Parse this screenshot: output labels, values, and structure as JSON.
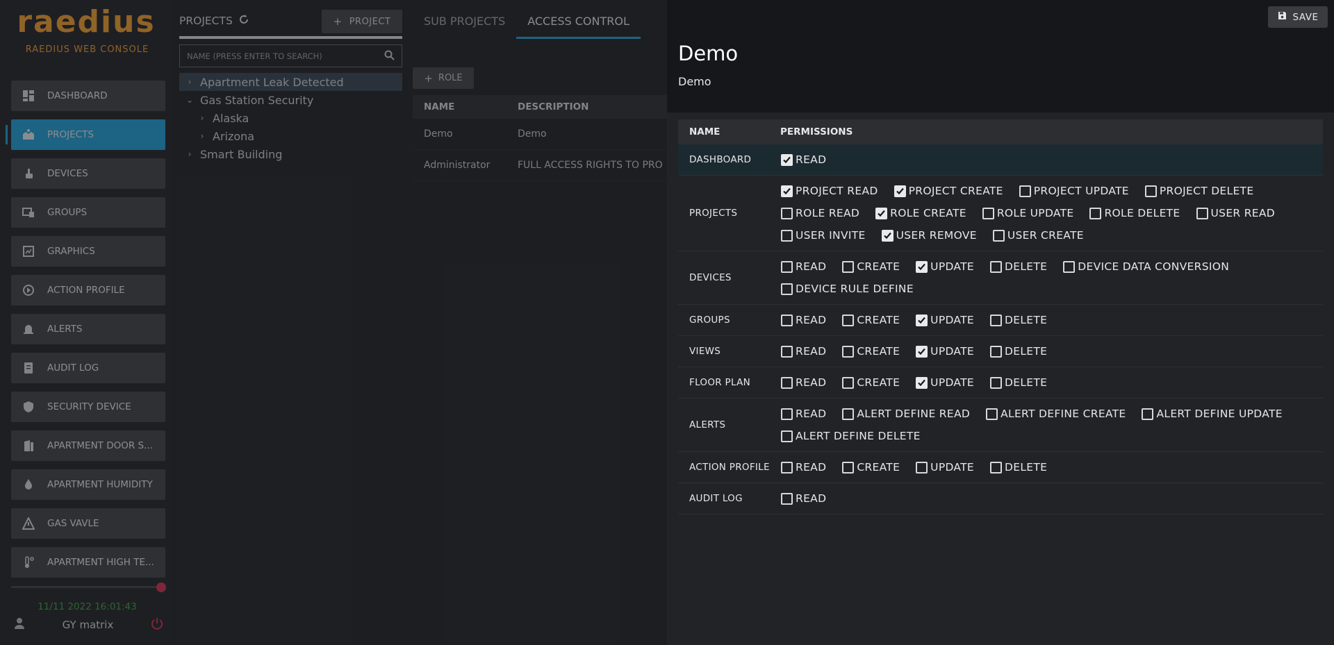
{
  "sidebar": {
    "logo": "raedius",
    "subtitle": "RAEDIUS WEB CONSOLE",
    "items": [
      {
        "label": "DASHBOARD",
        "icon": "dashboard-icon",
        "active": false
      },
      {
        "label": "PROJECTS",
        "icon": "projects-icon",
        "active": true
      },
      {
        "label": "DEVICES",
        "icon": "devices-icon",
        "active": false
      },
      {
        "label": "GROUPS",
        "icon": "groups-icon",
        "active": false
      },
      {
        "label": "GRAPHICS",
        "icon": "graphics-icon",
        "active": false
      },
      {
        "label": "ACTION PROFILE",
        "icon": "action-profile-icon",
        "active": false
      },
      {
        "label": "ALERTS",
        "icon": "alerts-icon",
        "active": false
      },
      {
        "label": "AUDIT LOG",
        "icon": "audit-log-icon",
        "active": false
      },
      {
        "label": "SECURITY DEVICE",
        "icon": "shield-icon",
        "active": false
      },
      {
        "label": "APARTMENT DOOR S...",
        "icon": "door-icon",
        "active": false
      },
      {
        "label": "APARTMENT HUMIDITY",
        "icon": "humidity-icon",
        "active": false
      },
      {
        "label": "GAS VAVLE",
        "icon": "warning-icon",
        "active": false
      },
      {
        "label": "APARTMENT HIGH TE...",
        "icon": "thermometer-icon",
        "active": false
      }
    ],
    "datetime": "11/11 2022 16:01:43",
    "user": "GY matrix"
  },
  "projects": {
    "title": "PROJECTS",
    "add_label": "PROJECT",
    "search_placeholder": "NAME (PRESS ENTER TO SEARCH)",
    "tree": [
      {
        "label": "Apartment Leak Detected",
        "level": 0,
        "expanded": false,
        "selected": true
      },
      {
        "label": "Gas Station Security",
        "level": 0,
        "expanded": true,
        "selected": false
      },
      {
        "label": "Alaska",
        "level": 1,
        "expanded": false,
        "selected": false
      },
      {
        "label": "Arizona",
        "level": 1,
        "expanded": false,
        "selected": false
      },
      {
        "label": "Smart Building",
        "level": 0,
        "expanded": false,
        "selected": false
      }
    ]
  },
  "main": {
    "tabs": [
      {
        "label": "SUB PROJECTS",
        "active": false
      },
      {
        "label": "ACCESS CONTROL",
        "active": true
      }
    ],
    "add_role_label": "ROLE",
    "table": {
      "headers": [
        "NAME",
        "DESCRIPTION"
      ],
      "rows": [
        [
          "Demo",
          "Demo"
        ],
        [
          "Administrator",
          "FULL ACCESS RIGHTS TO PRO"
        ]
      ]
    }
  },
  "panel": {
    "save_label": "SAVE",
    "role_name": "Demo",
    "role_description": "Demo",
    "headers": [
      "NAME",
      "PERMISSIONS"
    ],
    "rows": [
      {
        "name": "DASHBOARD",
        "highlight": true,
        "perms": [
          {
            "label": "READ",
            "checked": true
          }
        ]
      },
      {
        "name": "PROJECTS",
        "highlight": false,
        "perms": [
          {
            "label": "PROJECT READ",
            "checked": true
          },
          {
            "label": "PROJECT CREATE",
            "checked": true
          },
          {
            "label": "PROJECT UPDATE",
            "checked": false
          },
          {
            "label": "PROJECT DELETE",
            "checked": false
          },
          {
            "label": "ROLE READ",
            "checked": false
          },
          {
            "label": "ROLE CREATE",
            "checked": true
          },
          {
            "label": "ROLE UPDATE",
            "checked": false
          },
          {
            "label": "ROLE DELETE",
            "checked": false
          },
          {
            "label": "USER READ",
            "checked": false
          },
          {
            "label": "USER INVITE",
            "checked": false
          },
          {
            "label": "USER REMOVE",
            "checked": true
          },
          {
            "label": "USER CREATE",
            "checked": false
          }
        ]
      },
      {
        "name": "DEVICES",
        "highlight": false,
        "perms": [
          {
            "label": "READ",
            "checked": false
          },
          {
            "label": "CREATE",
            "checked": false
          },
          {
            "label": "UPDATE",
            "checked": true
          },
          {
            "label": "DELETE",
            "checked": false
          },
          {
            "label": "DEVICE DATA CONVERSION",
            "checked": false
          },
          {
            "label": "DEVICE RULE DEFINE",
            "checked": false
          }
        ]
      },
      {
        "name": "GROUPS",
        "highlight": false,
        "perms": [
          {
            "label": "READ",
            "checked": false
          },
          {
            "label": "CREATE",
            "checked": false
          },
          {
            "label": "UPDATE",
            "checked": true
          },
          {
            "label": "DELETE",
            "checked": false
          }
        ]
      },
      {
        "name": "VIEWS",
        "highlight": false,
        "perms": [
          {
            "label": "READ",
            "checked": false
          },
          {
            "label": "CREATE",
            "checked": false
          },
          {
            "label": "UPDATE",
            "checked": true
          },
          {
            "label": "DELETE",
            "checked": false
          }
        ]
      },
      {
        "name": "FLOOR PLAN",
        "highlight": false,
        "perms": [
          {
            "label": "READ",
            "checked": false
          },
          {
            "label": "CREATE",
            "checked": false
          },
          {
            "label": "UPDATE",
            "checked": true
          },
          {
            "label": "DELETE",
            "checked": false
          }
        ]
      },
      {
        "name": "ALERTS",
        "highlight": false,
        "perms": [
          {
            "label": "READ",
            "checked": false
          },
          {
            "label": "ALERT DEFINE READ",
            "checked": false
          },
          {
            "label": "ALERT DEFINE CREATE",
            "checked": false
          },
          {
            "label": "ALERT DEFINE UPDATE",
            "checked": false
          },
          {
            "label": "ALERT DEFINE DELETE",
            "checked": false
          }
        ]
      },
      {
        "name": "ACTION PROFILE",
        "highlight": false,
        "perms": [
          {
            "label": "READ",
            "checked": false
          },
          {
            "label": "CREATE",
            "checked": false
          },
          {
            "label": "UPDATE",
            "checked": false
          },
          {
            "label": "DELETE",
            "checked": false
          }
        ]
      },
      {
        "name": "AUDIT LOG",
        "highlight": false,
        "perms": [
          {
            "label": "READ",
            "checked": false
          }
        ]
      }
    ]
  },
  "colors": {
    "accent": "#2aa3d8",
    "brand": "#f0a23a",
    "datetime": "#3fa84a",
    "power": "#d23a5a"
  }
}
